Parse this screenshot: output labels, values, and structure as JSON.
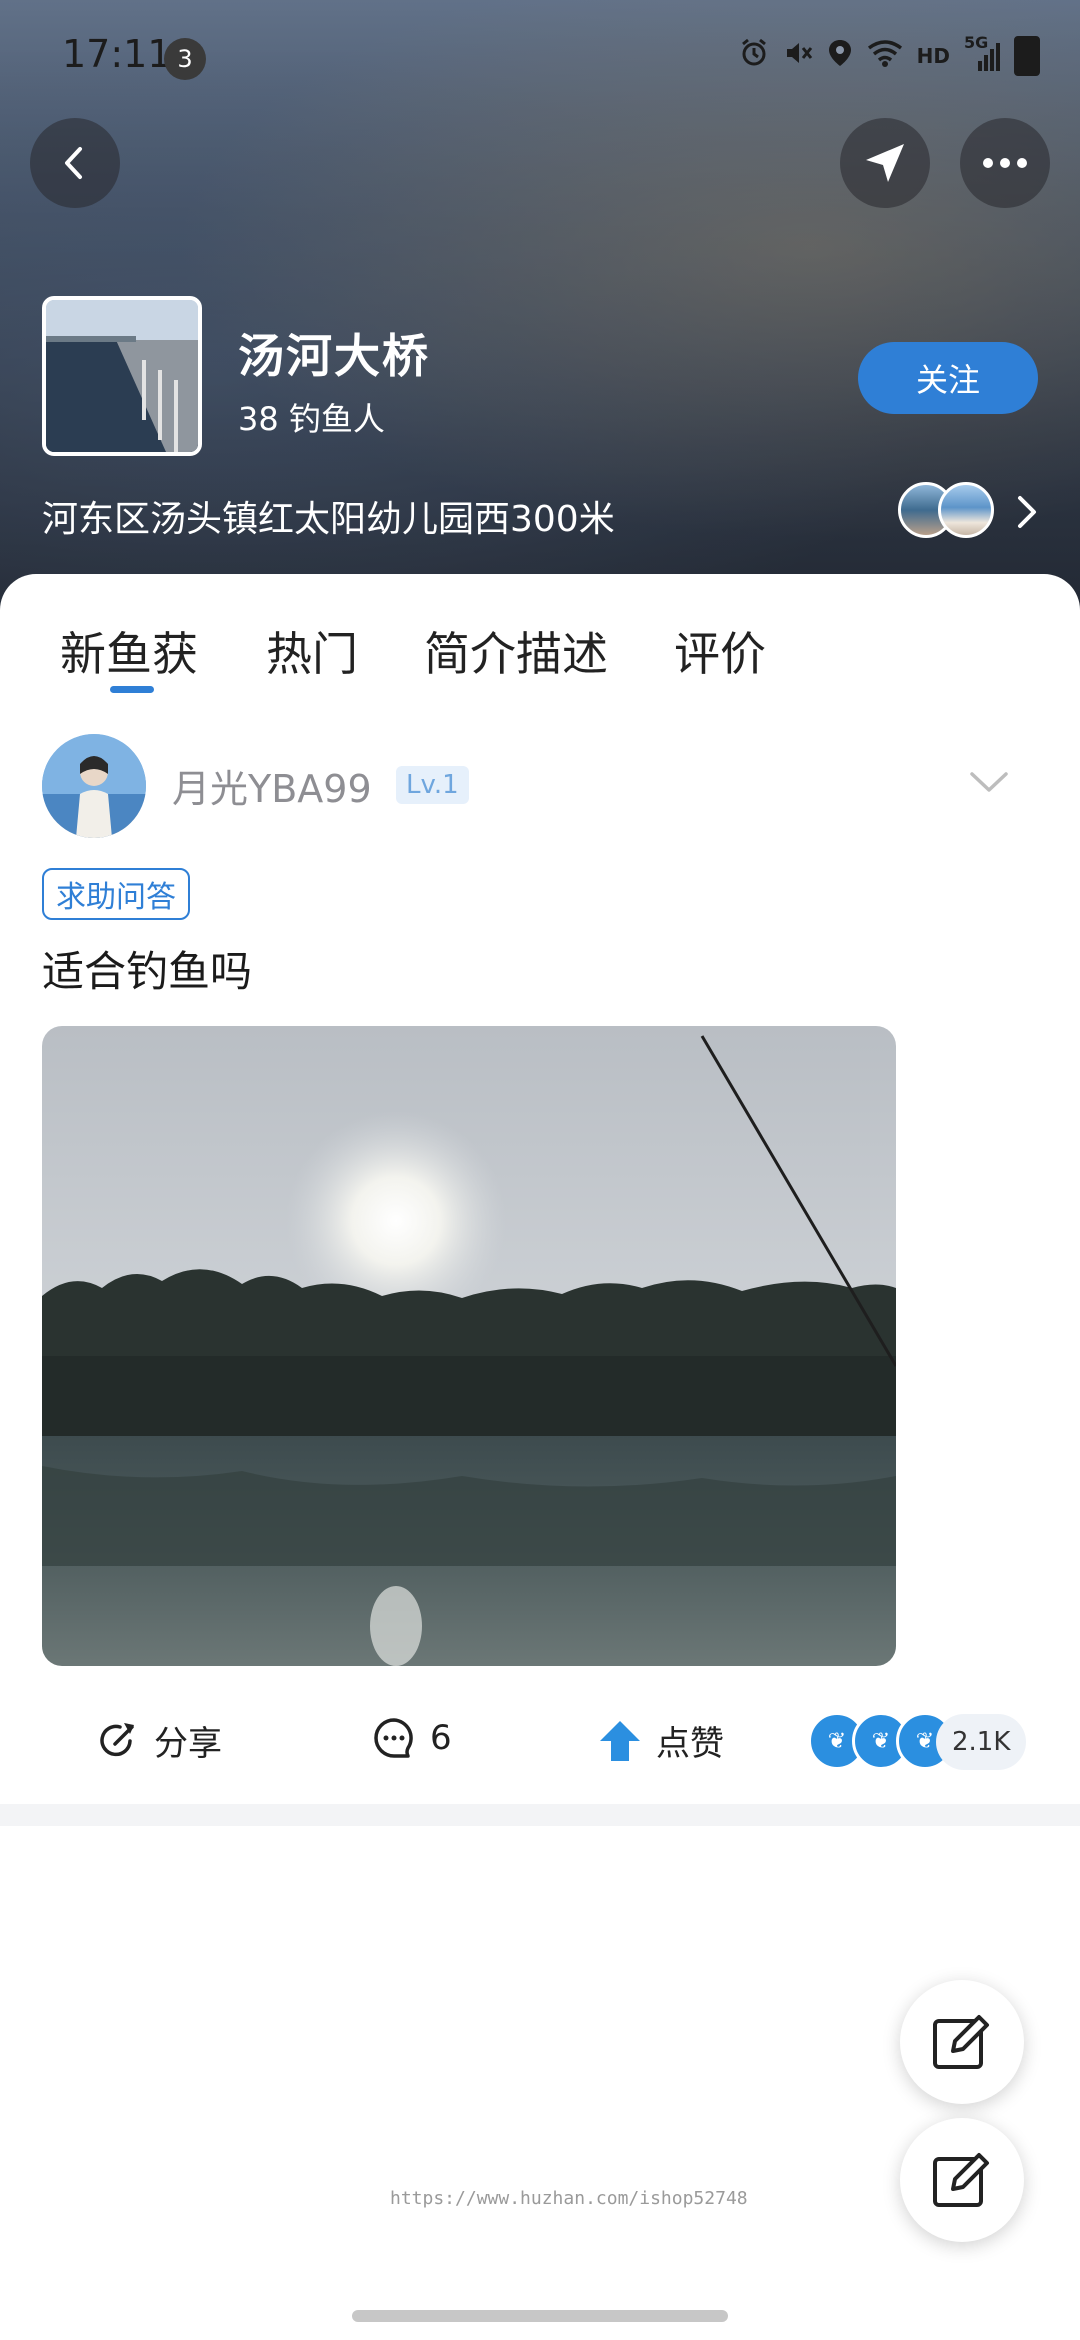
{
  "status_bar": {
    "time": "17:11",
    "notification_count": "3",
    "icons": [
      "alarm-icon",
      "mute-icon",
      "location-icon",
      "wifi-icon",
      "hd-label",
      "signal-5g-icon",
      "battery-icon"
    ],
    "hd_label": "HD",
    "network_label": "5G"
  },
  "header": {
    "back_icon": "chevron-left-icon",
    "navigate_icon": "navigation-arrow-icon",
    "more_icon": "more-dots-icon",
    "spot_name": "汤河大桥",
    "anglers_count": "38 钓鱼人",
    "follow_label": "关注",
    "address": "河东区汤头镇红太阳幼儿园西300米"
  },
  "tabs": [
    {
      "label": "新鱼获",
      "active": true
    },
    {
      "label": "热门",
      "active": false
    },
    {
      "label": "简介描述",
      "active": false
    },
    {
      "label": "评价",
      "active": false
    }
  ],
  "post": {
    "username": "月光YBA99",
    "level": "Lv.1",
    "tag": "求助问答",
    "text": "适合钓鱼吗",
    "actions": {
      "share_label": "分享",
      "comment_count": "6",
      "like_label": "点赞",
      "like_total": "2.1K"
    }
  },
  "watermark": "https://www.huzhan.com/ishop52748",
  "colors": {
    "accent": "#2f7fd6",
    "tab_indicator": "#2f7fd6",
    "level_badge_bg": "#e6f0fb",
    "like_bubble": "#2b8fe0"
  }
}
